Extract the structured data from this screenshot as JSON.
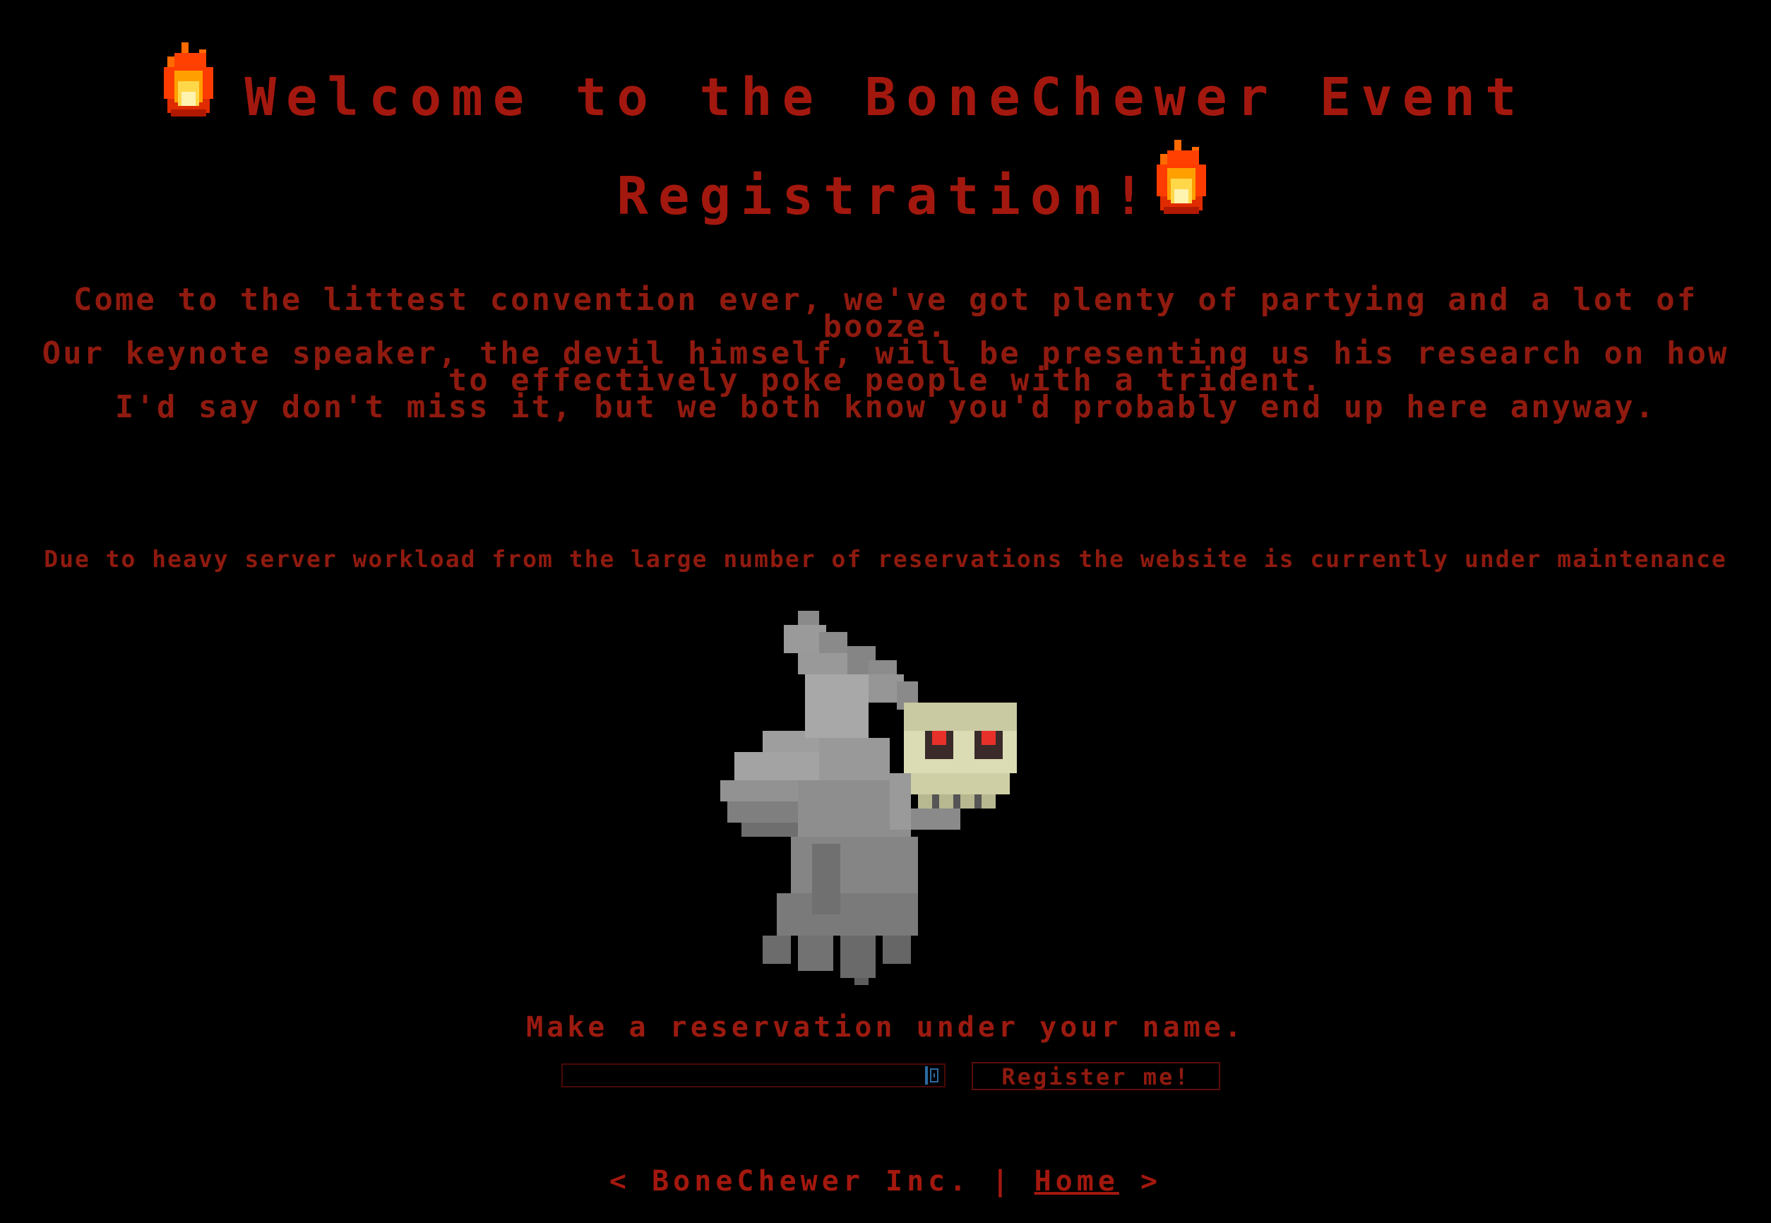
{
  "header": {
    "title_line1": "Welcome to the BoneChewer Event",
    "title_line2": "Registration!",
    "flame_icon": "fire-icon"
  },
  "intro": {
    "line1": "Come to the littest convention ever, we've got plenty of partying and a lot of booze.",
    "line2": "Our keynote speaker, the devil himself, will be presenting us his research on how to effectively poke people with a trident.",
    "line3": "I'd say don't miss it, but we both know you'd probably end up here anyway."
  },
  "notice": "Due to heavy server workload from the large number of reservations the website is currently under maintenance",
  "form": {
    "prompt": "Make a reservation under your name.",
    "name_value": "",
    "register_label": "Register me!"
  },
  "footer": {
    "open": "<",
    "company": "BoneChewer Inc.",
    "separator": "|",
    "home_link": "Home",
    "close": ">"
  },
  "colors": {
    "background": "#000000",
    "text_red": "#9b1a10",
    "ghost_gray": "#8c8c8c",
    "skull": "#d8d8b0",
    "eyes": "#e8302a"
  }
}
